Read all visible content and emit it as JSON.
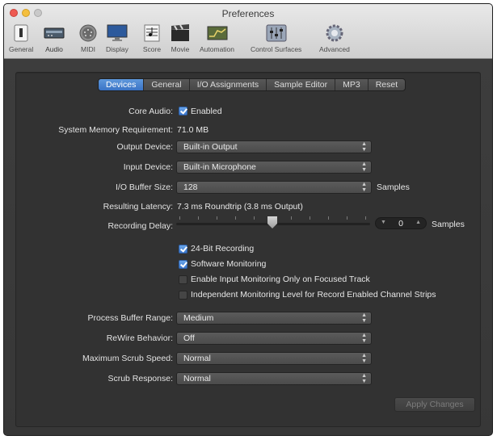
{
  "window": {
    "title": "Preferences"
  },
  "toolbar": {
    "items": [
      {
        "label": "General",
        "icon": "switch-icon"
      },
      {
        "label": "Audio",
        "icon": "audio-interface-icon"
      },
      {
        "label": "MIDI",
        "icon": "midi-connector-icon"
      },
      {
        "label": "Display",
        "icon": "monitor-icon"
      },
      {
        "label": "Score",
        "icon": "score-sheet-icon"
      },
      {
        "label": "Movie",
        "icon": "film-clapper-icon"
      },
      {
        "label": "Automation",
        "icon": "automation-curve-icon"
      },
      {
        "label": "Control Surfaces",
        "icon": "mixer-faders-icon"
      },
      {
        "label": "Advanced",
        "icon": "gear-icon"
      }
    ],
    "selected": "Audio"
  },
  "tabs": [
    "Devices",
    "General",
    "I/O Assignments",
    "Sample Editor",
    "MP3",
    "Reset"
  ],
  "active_tab": "Devices",
  "form": {
    "core_audio_label": "Core Audio:",
    "core_audio_value": "Enabled",
    "memory_label": "System Memory Requirement:",
    "memory_value": "71.0 MB",
    "output_device_label": "Output Device:",
    "output_device_value": "Built-in Output",
    "input_device_label": "Input Device:",
    "input_device_value": "Built-in Microphone",
    "buffer_size_label": "I/O Buffer Size:",
    "buffer_size_value": "128",
    "buffer_size_unit": "Samples",
    "latency_label": "Resulting Latency:",
    "latency_value": "7.3 ms Roundtrip (3.8 ms Output)",
    "recording_delay_label": "Recording Delay:",
    "recording_delay_value": "0",
    "recording_delay_unit": "Samples",
    "recording_delay_slider_level": 0.5
  },
  "checkboxes": [
    {
      "label": "24-Bit Recording",
      "checked": true
    },
    {
      "label": "Software Monitoring",
      "checked": true
    },
    {
      "label": "Enable Input Monitoring Only on Focused Track",
      "checked": false
    },
    {
      "label": "Independent Monitoring Level for Record Enabled Channel Strips",
      "checked": false
    }
  ],
  "lower_form": {
    "process_buffer_label": "Process Buffer Range:",
    "process_buffer_value": "Medium",
    "rewire_label": "ReWire Behavior:",
    "rewire_value": "Off",
    "max_scrub_label": "Maximum Scrub Speed:",
    "max_scrub_value": "Normal",
    "scrub_response_label": "Scrub Response:",
    "scrub_response_value": "Normal"
  },
  "buttons": {
    "apply": "Apply Changes"
  },
  "colors": {
    "accent": "#3a73c5",
    "panel": "#323232",
    "window": "#3a3a3a"
  }
}
